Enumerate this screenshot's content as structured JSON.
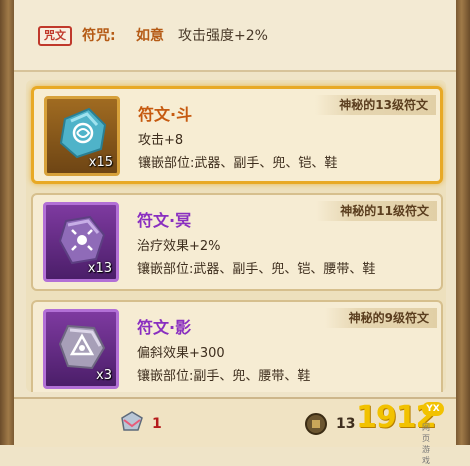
{
  "header": {
    "seal_text": "咒文",
    "rune_label": "符咒:",
    "rune_name": "如意",
    "rune_bonus": "攻击强度+2%"
  },
  "runes": [
    {
      "title": "符文·斗",
      "grade": "神秘的13级符文",
      "count": "x15",
      "effect": "攻击+8",
      "slots": "镶嵌部位:武器、副手、兜、铠、鞋",
      "icon": "blue-rune-stone-icon",
      "selected": true
    },
    {
      "title": "符文·冥",
      "grade": "神秘的11级符文",
      "count": "x13",
      "effect": "治疗效果+2%",
      "slots": "镶嵌部位:武器、副手、兜、铠、腰带、鞋",
      "icon": "purple-rune-stone-icon",
      "selected": false
    },
    {
      "title": "符文·影",
      "grade": "神秘的9级符文",
      "count": "x3",
      "effect": "偏斜效果+300",
      "slots": "镶嵌部位:副手、兜、腰带、鞋",
      "icon": "grey-rune-stone-icon",
      "selected": false
    }
  ],
  "footer": {
    "stone_count": "1",
    "coin_count": "13"
  },
  "watermark": {
    "number": "1912",
    "badge": "YX",
    "sub": "网页游戏"
  },
  "colors": {
    "selected_border": "#e8a925",
    "orange_title": "#c65a10",
    "purple_title": "#8a2fc0",
    "stone_count": "#b51b1b"
  }
}
